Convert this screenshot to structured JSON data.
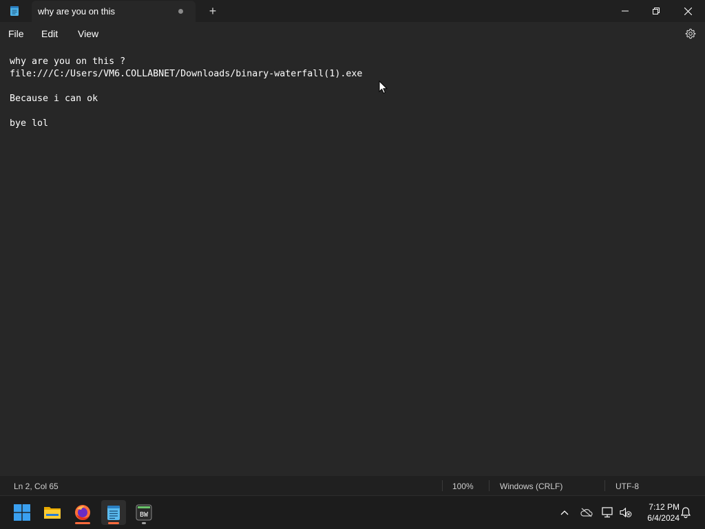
{
  "window": {
    "tab_title": "why are you on this",
    "new_tab_symbol": "+"
  },
  "menu": {
    "file": "File",
    "edit": "Edit",
    "view": "View"
  },
  "editor": {
    "lines": [
      "why are you on this ?",
      "file:///C:/Users/VM6.COLLABNET/Downloads/binary-waterfall(1).exe",
      "",
      "Because i can ok",
      "",
      "bye lol"
    ]
  },
  "status": {
    "position": "Ln 2, Col 65",
    "zoom": "100%",
    "line_ending": "Windows (CRLF)",
    "encoding": "UTF-8"
  },
  "taskbar": {
    "apps": [
      "start-icon",
      "file-explorer-icon",
      "firefox-icon",
      "notepad-icon",
      "binary-waterfall-icon"
    ],
    "bw_label": "BW"
  },
  "tray": {
    "time": "7:12 PM",
    "date": "6/4/2024"
  },
  "colors": {
    "background": "#272727",
    "titlebar": "#202020",
    "taskbar": "#1c1c1c",
    "accent": "#4cc2ff"
  }
}
